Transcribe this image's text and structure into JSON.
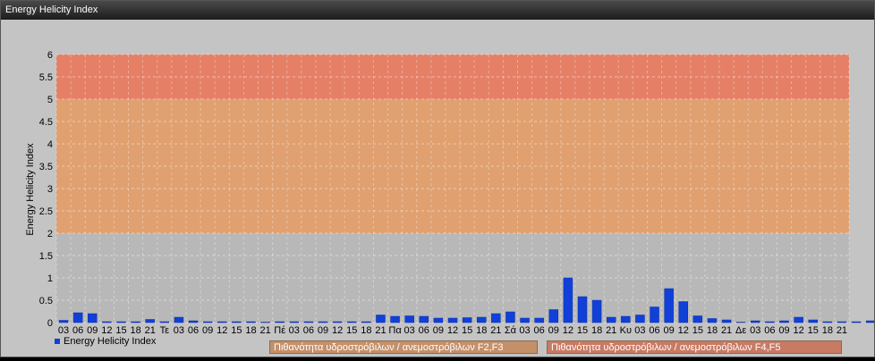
{
  "window": {
    "title": "Energy Helicity Index"
  },
  "legend": {
    "series_label": "Energy Helicity Index"
  },
  "bands": {
    "f23_label": "Πιθανότητα υδροστρόβιλων / ανεμοστρόβιλων F2,F3",
    "f45_label": "Πιθανότητα υδροστρόβιλων / ανεμοστρόβιλων F4,F5"
  },
  "colors": {
    "bar": "#1040d8",
    "band_low": "#b8b8b8",
    "band_mid": "#e0a070",
    "band_high": "#e58066"
  },
  "chart_data": {
    "type": "bar",
    "ylabel": "Energy Helicity Index",
    "ylim": [
      0,
      6
    ],
    "yticks": [
      "0",
      "0.5",
      "1",
      "1.5",
      "2",
      "2.5",
      "3",
      "3.5",
      "4",
      "4.5",
      "5",
      "5.5",
      "6"
    ],
    "ytick_values": [
      0,
      0.5,
      1,
      1.5,
      2,
      2.5,
      3,
      3.5,
      4,
      4.5,
      5,
      5.5,
      6
    ],
    "bands": [
      {
        "from": 0,
        "to": 2,
        "color": "#b8b8b8"
      },
      {
        "from": 2,
        "to": 5,
        "color": "#e0a070"
      },
      {
        "from": 5,
        "to": 6,
        "color": "#e58066"
      }
    ],
    "grid": true,
    "categories": [
      "03",
      "06",
      "09",
      "12",
      "15",
      "18",
      "21",
      "Τε",
      "03",
      "06",
      "09",
      "12",
      "15",
      "18",
      "21",
      "Πέ",
      "03",
      "06",
      "09",
      "12",
      "15",
      "18",
      "21",
      "Πα",
      "03",
      "06",
      "09",
      "12",
      "15",
      "18",
      "21",
      "Σά",
      "03",
      "06",
      "09",
      "12",
      "15",
      "18",
      "21",
      "Κυ",
      "03",
      "06",
      "09",
      "12",
      "15",
      "18",
      "21",
      "Δε",
      "03",
      "06",
      "09",
      "12",
      "15",
      "18",
      "21"
    ],
    "series": [
      {
        "name": "Energy Helicity Index",
        "values": [
          0.05,
          0.22,
          0.2,
          0.02,
          0.02,
          0.02,
          0.07,
          0.02,
          0.12,
          0.04,
          0.02,
          0.02,
          0.02,
          0.02,
          0.01,
          0.02,
          0.02,
          0.02,
          0.02,
          0.02,
          0.02,
          0.02,
          0.17,
          0.14,
          0.15,
          0.14,
          0.1,
          0.1,
          0.11,
          0.12,
          0.2,
          0.24,
          0.1,
          0.1,
          0.29,
          1.0,
          0.58,
          0.5,
          0.12,
          0.14,
          0.17,
          0.35,
          0.76,
          0.47,
          0.15,
          0.09,
          0.06,
          0.01,
          0.04,
          0.02,
          0.04,
          0.12,
          0.06,
          0.02,
          0.02,
          0.02,
          0.04
        ]
      }
    ]
  }
}
